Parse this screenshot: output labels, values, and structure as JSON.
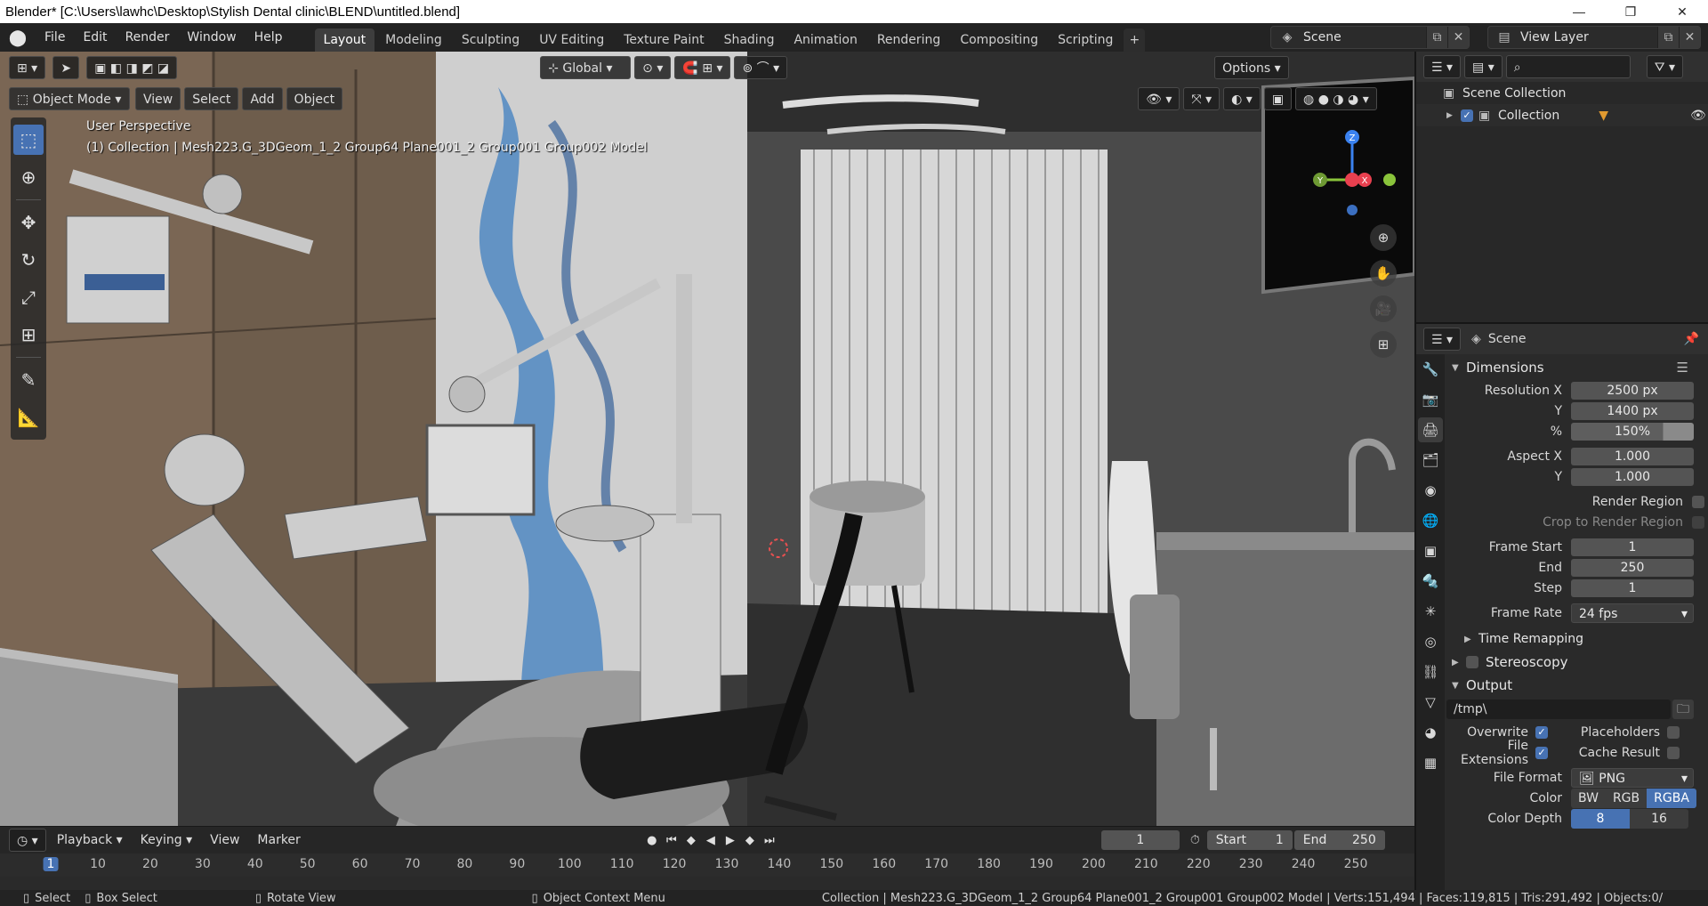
{
  "window": {
    "title": "Blender* [C:\\Users\\lawhc\\Desktop\\Stylish Dental clinic\\BLEND\\untitled.blend]",
    "minimize": "—",
    "maximize": "❐",
    "close": "✕"
  },
  "menu": {
    "file": "File",
    "edit": "Edit",
    "render": "Render",
    "window": "Window",
    "help": "Help"
  },
  "workspace_tabs": [
    "Layout",
    "Modeling",
    "Sculpting",
    "UV Editing",
    "Texture Paint",
    "Shading",
    "Animation",
    "Rendering",
    "Compositing",
    "Scripting"
  ],
  "add_tab": "+",
  "scene_selector": {
    "label": "Scene"
  },
  "view_layer_selector": {
    "label": "View Layer"
  },
  "viewport": {
    "transform_orientation": "Global",
    "options_label": "Options",
    "mode": "Object Mode",
    "view_menu": "View",
    "select_menu": "Select",
    "add_menu": "Add",
    "object_menu": "Object",
    "perspective_label": "User Perspective",
    "collection_info": "(1) Collection | Mesh223.G_3DGeom_1_2 Group64 Plane001_2 Group001 Group002 Model",
    "gizmo_axes": {
      "z": "Z",
      "y": "Y",
      "x": "X"
    }
  },
  "timeline": {
    "playback": "Playback",
    "keying": "Keying",
    "view": "View",
    "marker": "Marker",
    "current_frame": "1",
    "start_label": "Start",
    "start_value": "1",
    "end_label": "End",
    "end_value": "250",
    "ruler_ticks": [
      "1",
      "10",
      "20",
      "30",
      "40",
      "50",
      "60",
      "70",
      "80",
      "90",
      "100",
      "110",
      "120",
      "130",
      "140",
      "150",
      "160",
      "170",
      "180",
      "190",
      "200",
      "210",
      "220",
      "230",
      "240",
      "250"
    ]
  },
  "statusbar": {
    "select": "Select",
    "box_select": "Box Select",
    "rotate_view": "Rotate View",
    "context_menu": "Object Context Menu",
    "stats": "Collection | Mesh223.G_3DGeom_1_2 Group64 Plane001_2 Group001 Group002 Model | Verts:151,494 | Faces:119,815 | Tris:291,492 | Objects:0/"
  },
  "outliner": {
    "scene_collection": "Scene Collection",
    "collection": "Collection"
  },
  "properties": {
    "context": "Scene",
    "dimensions_title": "Dimensions",
    "resolution_x_label": "Resolution X",
    "resolution_x": "2500 px",
    "y_label": "Y",
    "resolution_y": "1400 px",
    "percent_label": "%",
    "percent": "150%",
    "percent_fill": 0.75,
    "aspect_x_label": "Aspect X",
    "aspect_x": "1.000",
    "aspect_y_label": "Y",
    "aspect_y": "1.000",
    "render_region": "Render Region",
    "crop_region": "Crop to Render Region",
    "frame_start_label": "Frame Start",
    "frame_start": "1",
    "end_label": "End",
    "frame_end": "250",
    "step_label": "Step",
    "frame_step": "1",
    "frame_rate_label": "Frame Rate",
    "frame_rate": "24 fps",
    "time_remapping": "Time Remapping",
    "stereoscopy": "Stereoscopy",
    "output_title": "Output",
    "output_path": "/tmp\\",
    "overwrite": "Overwrite",
    "placeholders": "Placeholders",
    "file_extensions": "File Extensions",
    "cache_result": "Cache Result",
    "file_format_label": "File Format",
    "file_format": "PNG",
    "color_label": "Color",
    "color_options": [
      "BW",
      "RGB",
      "RGBA"
    ],
    "color_depth_label": "Color Depth",
    "color_depth_options": [
      "8",
      "16"
    ]
  },
  "colors": {
    "accent": "#4772b3",
    "axis_x": "#e8404f",
    "axis_y": "#8ac43b",
    "axis_z": "#3b82f0"
  }
}
